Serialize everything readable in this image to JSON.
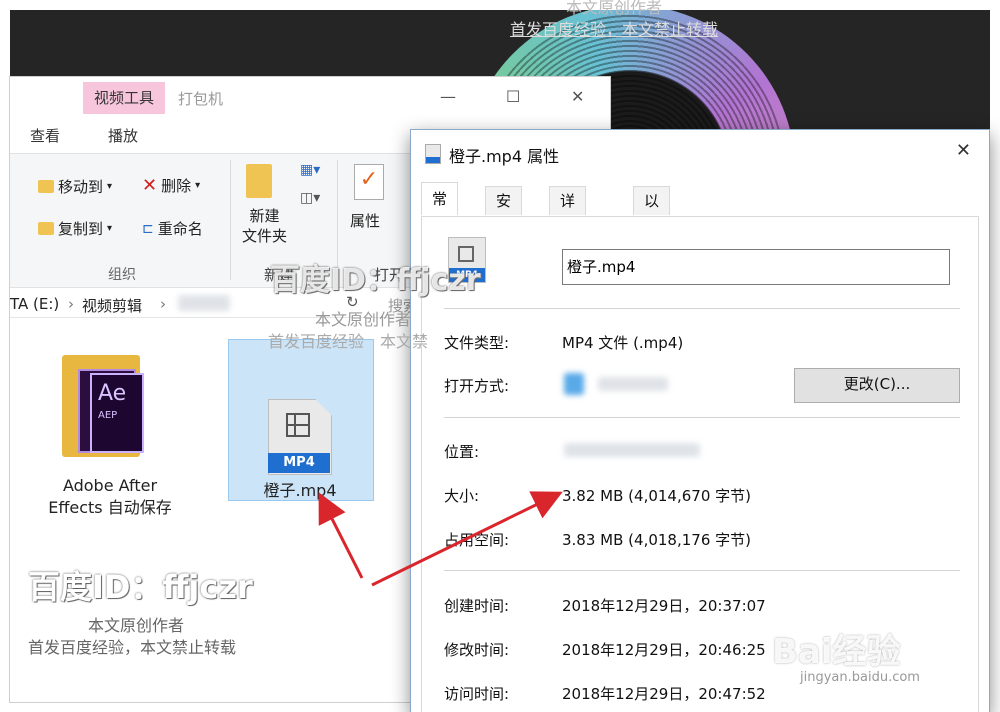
{
  "explorer": {
    "context_tab": "视频工具",
    "pack_tab": "打包机",
    "view_tab": "查看",
    "play_tab": "播放",
    "window_controls": {
      "minimize": "—",
      "maximize": "☐",
      "close": "✕"
    },
    "ribbon": {
      "move_to": "移动到",
      "copy_to": "复制到",
      "delete": "删除",
      "rename": "重命名",
      "new_folder_l1": "新建",
      "new_folder_l2": "文件夹",
      "properties": "属性",
      "group_organize": "组织",
      "group_new": "新建",
      "group_open": "打开"
    },
    "address": {
      "drive": "TA (E:)",
      "folder": "视频剪辑",
      "search_label": "搜索"
    },
    "items": [
      {
        "line1": "Adobe After",
        "line2": "Effects 自动保存",
        "icon_text": "Ae",
        "icon_sub": "AEP"
      },
      {
        "label": "橙子.mp4",
        "badge": "MP4"
      }
    ]
  },
  "dialog": {
    "title": "橙子.mp4 属性",
    "close": "✕",
    "tabs": [
      "常规",
      "安全",
      "详细信息",
      "以前的版本"
    ],
    "badge": "MP4",
    "file_name": "橙子.mp4",
    "rows": {
      "file_type_label": "文件类型:",
      "file_type_value": "MP4 文件 (.mp4)",
      "open_with_label": "打开方式:",
      "change_button": "更改(C)...",
      "location_label": "位置:",
      "size_label": "大小:",
      "size_value": "3.82 MB (4,014,670 字节)",
      "disk_label": "占用空间:",
      "disk_value": "3.83 MB (4,018,176 字节)",
      "created_label": "创建时间:",
      "created_value": "2018年12月29日，20:37:07",
      "modified_label": "修改时间:",
      "modified_value": "2018年12月29日，20:46:25",
      "accessed_label": "访问时间:",
      "accessed_value": "2018年12月29日，20:47:52"
    }
  },
  "watermark": {
    "id_text": "百度ID：ffjczr",
    "author": "本文原创作者",
    "notice": "首发百度经验，本文禁止转载",
    "top_author": "本文原创作者",
    "top_notice": "首发百度经验，本文禁止转载",
    "mid_id": "百度ID：ffjczr",
    "mid_author": "本文原创作者",
    "mid_notice": "首发百度经验　本文禁",
    "brand": "Bai经验",
    "brand_url": "jingyan.baidu.com"
  }
}
